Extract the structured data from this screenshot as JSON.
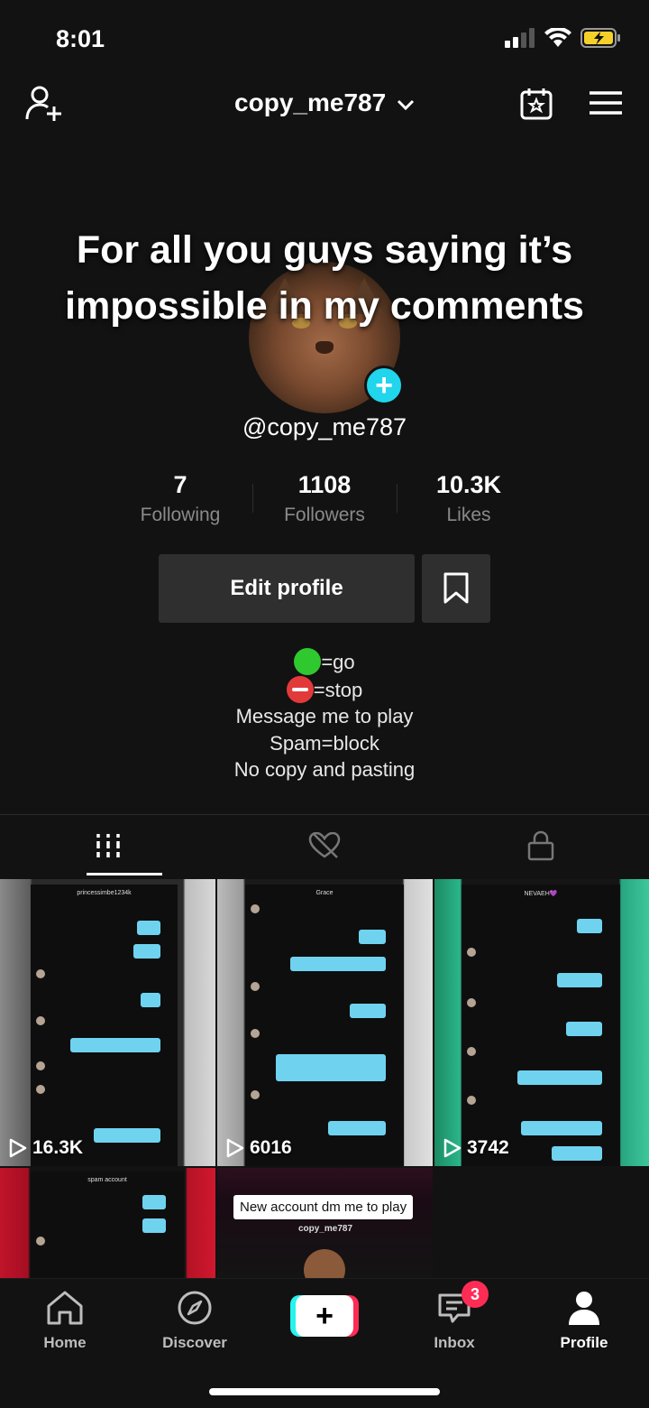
{
  "status": {
    "time": "8:01"
  },
  "header": {
    "username": "copy_me787"
  },
  "caption": {
    "line1": "For all you guys saying it’s",
    "line2": "impossible in my comments"
  },
  "profile": {
    "handle": "@copy_me787",
    "stats": [
      {
        "value": "7",
        "label": "Following"
      },
      {
        "value": "1108",
        "label": "Followers"
      },
      {
        "value": "10.3K",
        "label": "Likes"
      }
    ],
    "edit_label": "Edit profile",
    "bio": {
      "go": "=go",
      "stop": "=stop",
      "line3": "Message me to play",
      "line4": "Spam=block",
      "line5": "No copy and pasting"
    }
  },
  "videos": [
    {
      "views": "16.3K",
      "title": "princessimbe1234k"
    },
    {
      "views": "6016",
      "title": "Grace"
    },
    {
      "views": "3742",
      "title": "NEVAEH💜"
    },
    {
      "title": "spam account"
    },
    {
      "label": "New account dm me to play",
      "title": "copy_me787"
    }
  ],
  "nav": {
    "home": "Home",
    "discover": "Discover",
    "inbox": "Inbox",
    "inbox_badge": "3",
    "profile": "Profile"
  },
  "colors": {
    "accent_cyan": "#20d5ec",
    "accent_red": "#fe2c55",
    "bubble": "#6fd3ef"
  }
}
